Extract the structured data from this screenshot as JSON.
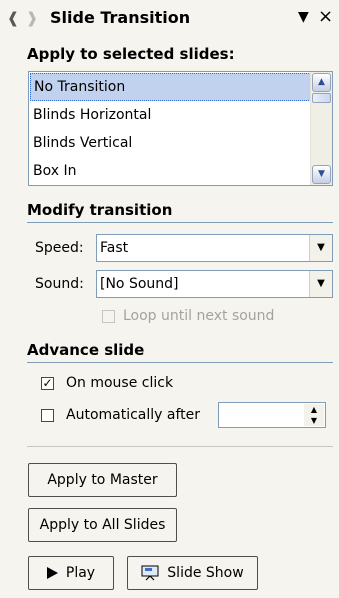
{
  "pane": {
    "title": "Slide Transition"
  },
  "apply": {
    "heading": "Apply to selected slides:",
    "items": [
      {
        "label": "No Transition",
        "selected": true
      },
      {
        "label": "Blinds Horizontal",
        "selected": false
      },
      {
        "label": "Blinds Vertical",
        "selected": false
      },
      {
        "label": "Box In",
        "selected": false
      }
    ]
  },
  "modify": {
    "heading": "Modify transition",
    "speed_label": "Speed:",
    "speed_value": "Fast",
    "sound_label": "Sound:",
    "sound_value": "[No Sound]",
    "loop_label": "Loop until next sound",
    "loop_checked": false,
    "loop_enabled": false
  },
  "advance": {
    "heading": "Advance slide",
    "mouse_click_label": "On mouse click",
    "mouse_click_checked": true,
    "auto_label": "Automatically after",
    "auto_checked": false,
    "auto_value": ""
  },
  "buttons": {
    "apply_master": "Apply to Master",
    "apply_all": "Apply to All Slides",
    "play": "Play",
    "slide_show": "Slide Show"
  },
  "icons": {
    "back": "back-arrow-icon",
    "forward": "forward-arrow-icon",
    "menu": "dropdown-arrow-icon",
    "close": "close-icon",
    "play": "play-icon",
    "slide_show": "slide-show-icon"
  },
  "colors": {
    "pane_background": "#f5f4ee",
    "selection": "#c1d2ee",
    "field_border": "#7f9db9"
  }
}
